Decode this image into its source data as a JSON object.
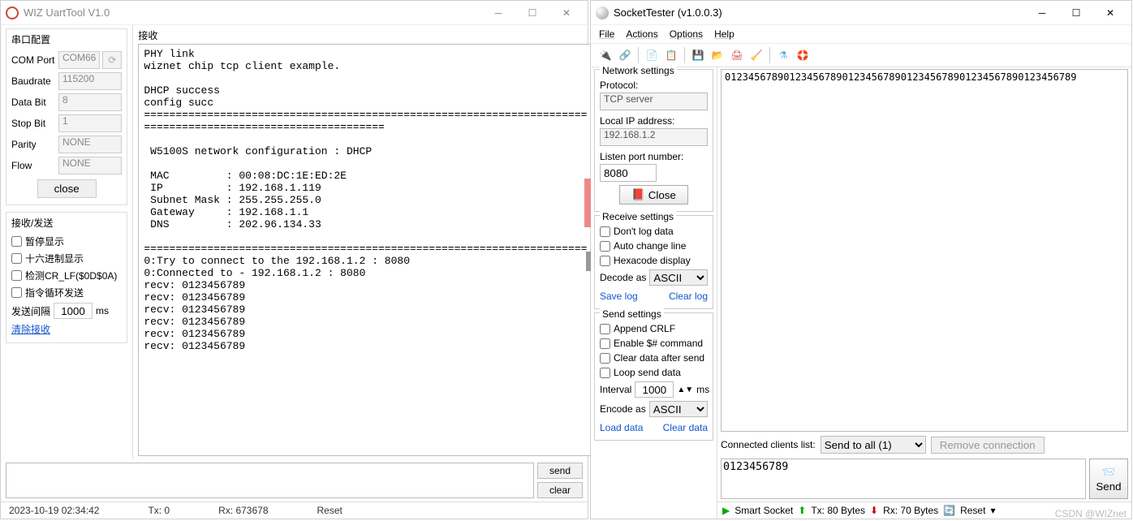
{
  "w1": {
    "title": "WIZ UartTool V1.0",
    "serial_group": "串口配置",
    "labels": {
      "comport": "COM Port",
      "baud": "Baudrate",
      "databit": "Data Bit",
      "stopbit": "Stop Bit",
      "parity": "Parity",
      "flow": "Flow"
    },
    "values": {
      "comport": "COM66",
      "baud": "115200",
      "databit": "8",
      "stopbit": "1",
      "parity": "NONE",
      "flow": "NONE"
    },
    "close_btn": "close",
    "rx_group": "接收/发送",
    "chk": {
      "pause": "暂停显示",
      "hex": "十六进制显示",
      "crlf": "检测CR_LF($0D$0A)",
      "loop": "指令循环发送"
    },
    "interval_label": "发送间隔",
    "interval_val": "1000",
    "interval_unit": "ms",
    "clear_link": "清除接收",
    "recv_title": "接收",
    "recv_text": "PHY link\nwiznet chip tcp client example.\n\nDHCP success\nconfig succ\n======================================================================\n======================================\n\n W5100S network configuration : DHCP\n\n MAC         : 00:08:DC:1E:ED:2E\n IP          : 192.168.1.119\n Subnet Mask : 255.255.255.0\n Gateway     : 192.168.1.1\n DNS         : 202.96.134.33\n\n======================================================================\n0:Try to connect to the 192.168.1.2 : 8080\n0:Connected to - 192.168.1.2 : 8080\nrecv: 0123456789\nrecv: 0123456789\nrecv: 0123456789\nrecv: 0123456789\nrecv: 0123456789\nrecv: 0123456789",
    "send_btn": "send",
    "clear_btn": "clear",
    "status": {
      "time": "2023-10-19 02:34:42",
      "tx": "Tx: 0",
      "rx": "Rx: 673678",
      "reset": "Reset"
    }
  },
  "w2": {
    "title": "SocketTester (v1.0.0.3)",
    "menu": [
      "File",
      "Actions",
      "Options",
      "Help"
    ],
    "net": {
      "group": "Network settings",
      "proto_lbl": "Protocol:",
      "proto": "TCP server",
      "ip_lbl": "Local IP address:",
      "ip": "192.168.1.2",
      "port_lbl": "Listen port number:",
      "port": "8080",
      "close": "Close"
    },
    "recv": {
      "group": "Receive settings",
      "nolog": "Don't log data",
      "autoline": "Auto change line",
      "hex": "Hexacode display",
      "decode_lbl": "Decode as",
      "decode": "ASCII",
      "save": "Save log",
      "clear": "Clear log"
    },
    "send": {
      "group": "Send settings",
      "crlf": "Append CRLF",
      "dollar": "Enable $# command",
      "clearafter": "Clear data after send",
      "loop": "Loop send data",
      "interval_lbl": "Interval",
      "interval": "1000",
      "unit": "ms",
      "encode_lbl": "Encode as",
      "encode": "ASCII",
      "load": "Load data",
      "clear": "Clear data"
    },
    "recv_text": "012345678901234567890123456789012345678901234567890123456789",
    "conn": {
      "label": "Connected clients list:",
      "sel": "Send to all (1)",
      "remove": "Remove connection"
    },
    "sendbox": "0123456789",
    "send_btn": "Send",
    "status": {
      "sock": "Smart Socket",
      "tx": "Tx: 80 Bytes",
      "rx": "Rx: 70 Bytes",
      "reset": "Reset"
    },
    "watermark": "CSDN @WIZnet"
  }
}
